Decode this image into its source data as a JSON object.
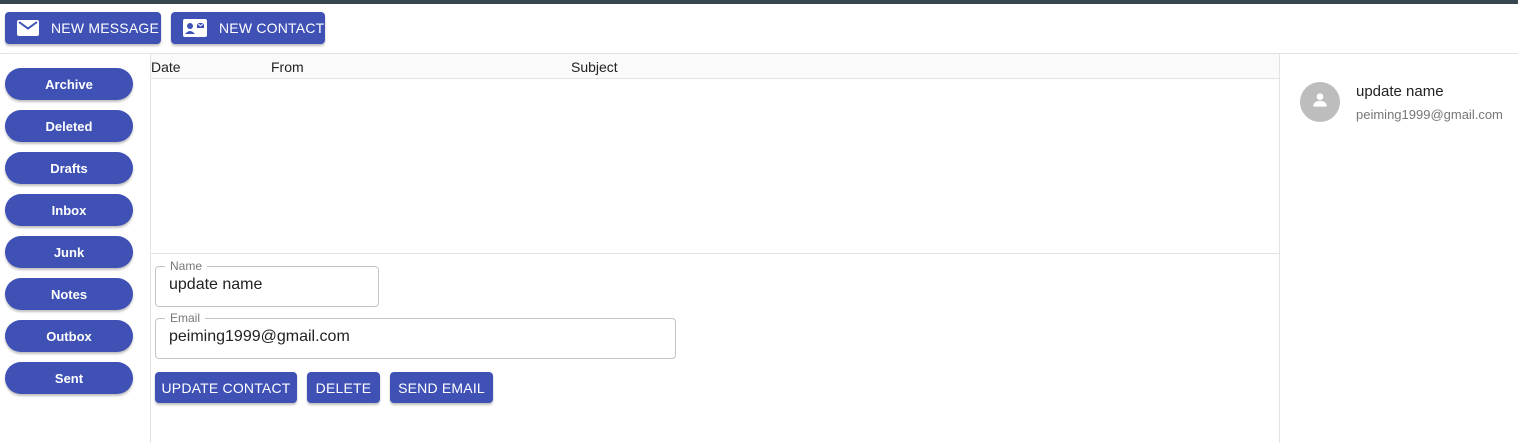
{
  "toolbar": {
    "new_message_label": "NEW MESSAGE",
    "new_contact_label": "NEW CONTACT",
    "new_message_icon": "mail-icon",
    "new_contact_icon": "contact-card-icon"
  },
  "sidebar": {
    "items": [
      {
        "label": "Archive"
      },
      {
        "label": "Deleted"
      },
      {
        "label": "Drafts"
      },
      {
        "label": "Inbox"
      },
      {
        "label": "Junk"
      },
      {
        "label": "Notes"
      },
      {
        "label": "Outbox"
      },
      {
        "label": "Sent"
      }
    ]
  },
  "message_list": {
    "columns": [
      "Date",
      "From",
      "Subject"
    ],
    "rows": []
  },
  "contact_form": {
    "name_label": "Name",
    "name_value": "update name",
    "email_label": "Email",
    "email_value": "peiming1999@gmail.com",
    "update_label": "UPDATE CONTACT",
    "delete_label": "DELETE",
    "send_label": "SEND EMAIL"
  },
  "contacts": [
    {
      "name": "update name",
      "email": "peiming1999@gmail.com",
      "avatar_icon": "person-icon"
    }
  ],
  "colors": {
    "accent": "#3f51b5",
    "top_bar": "#37474f",
    "avatar_bg": "#bdbdbd"
  }
}
